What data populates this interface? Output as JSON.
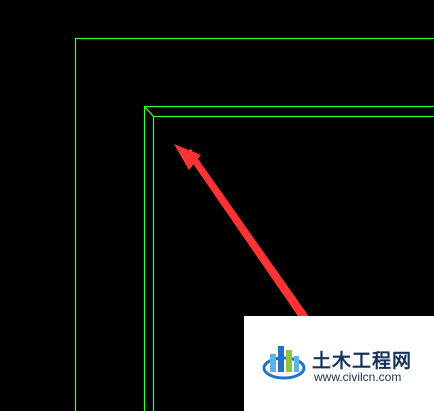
{
  "drawing": {
    "background": "#000000",
    "line_color": "#33ff33",
    "arrow_color": "#ff3333"
  },
  "watermark": {
    "title": "土木工程网",
    "url": "www.civilcn.com",
    "text_color": "#16325c",
    "logo_colors": [
      "#1e73c8",
      "#5ab4e6",
      "#8cc63f"
    ]
  }
}
